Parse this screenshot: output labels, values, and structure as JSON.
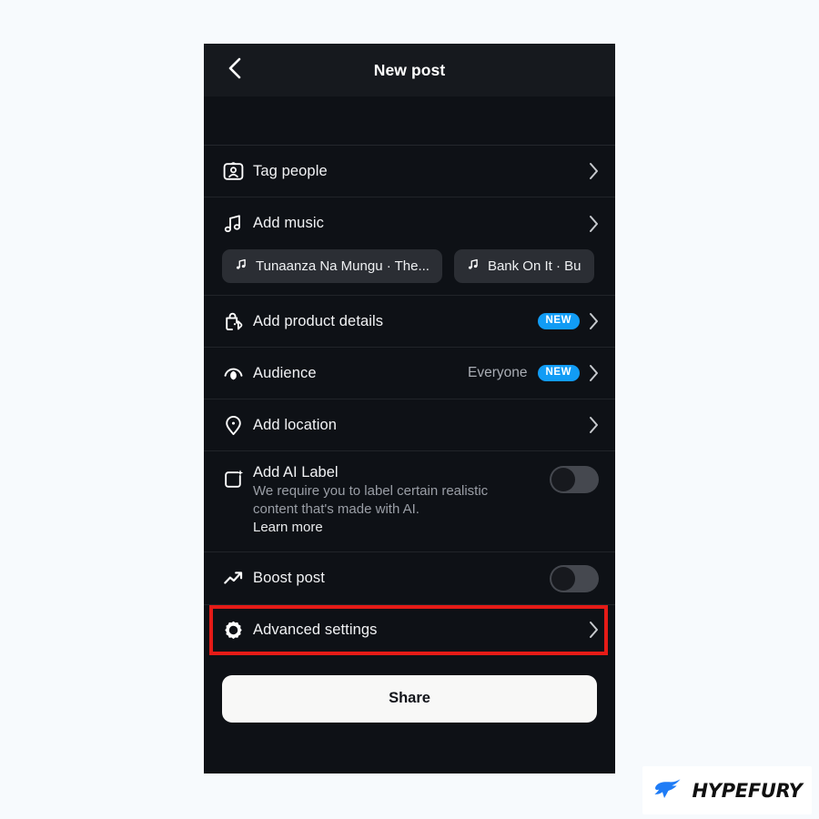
{
  "page": {
    "background_color": "#f7fafd",
    "panel_background": "#0e1116"
  },
  "header": {
    "title": "New post",
    "back_icon": "chevron-left-icon"
  },
  "rows": [
    {
      "id": "tag-people",
      "icon": "tag-people-icon",
      "label": "Tag people",
      "value": "",
      "badge": "",
      "accessory": "chevron"
    },
    {
      "id": "add-music",
      "icon": "music-note-icon",
      "label": "Add music",
      "value": "",
      "badge": "",
      "accessory": "chevron"
    },
    {
      "id": "product-details",
      "icon": "shopping-bag-tag-icon",
      "label": "Add product details",
      "value": "",
      "badge": "NEW",
      "accessory": "chevron"
    },
    {
      "id": "audience",
      "icon": "audience-eye-icon",
      "label": "Audience",
      "value": "Everyone",
      "badge": "NEW",
      "accessory": "chevron"
    },
    {
      "id": "add-location",
      "icon": "location-pin-icon",
      "label": "Add location",
      "value": "",
      "badge": "",
      "accessory": "chevron"
    },
    {
      "id": "boost-post",
      "icon": "trending-up-icon",
      "label": "Boost post",
      "value": "",
      "badge": "",
      "accessory": "toggle"
    },
    {
      "id": "advanced-settings",
      "icon": "gear-icon",
      "label": "Advanced settings",
      "value": "",
      "badge": "",
      "accessory": "chevron"
    }
  ],
  "music_suggestions": [
    {
      "icon": "music-note-icon",
      "title": "Tunaanza Na Mungu · The..."
    },
    {
      "icon": "music-note-icon",
      "title": "Bank On It · Bu"
    }
  ],
  "ai_label": {
    "icon": "ai-sparkle-icon",
    "title": "Add AI Label",
    "description": "We require you to label certain realistic content that's made with AI.",
    "link": "Learn more",
    "toggle_state": "off"
  },
  "boost": {
    "toggle_state": "off"
  },
  "share": {
    "label": "Share"
  },
  "highlight": {
    "target": "advanced-settings",
    "color": "#e51b17"
  },
  "watermark": {
    "text": "HYPEFURY",
    "icon": "hypefury-bird-icon",
    "color": "#1f7cf6"
  },
  "colors": {
    "accent_blue": "#119cf5",
    "badge_text": "#ffffff",
    "row_label": "#f2f3f5",
    "muted_text": "#9a9ea6",
    "separator": "#212429"
  }
}
